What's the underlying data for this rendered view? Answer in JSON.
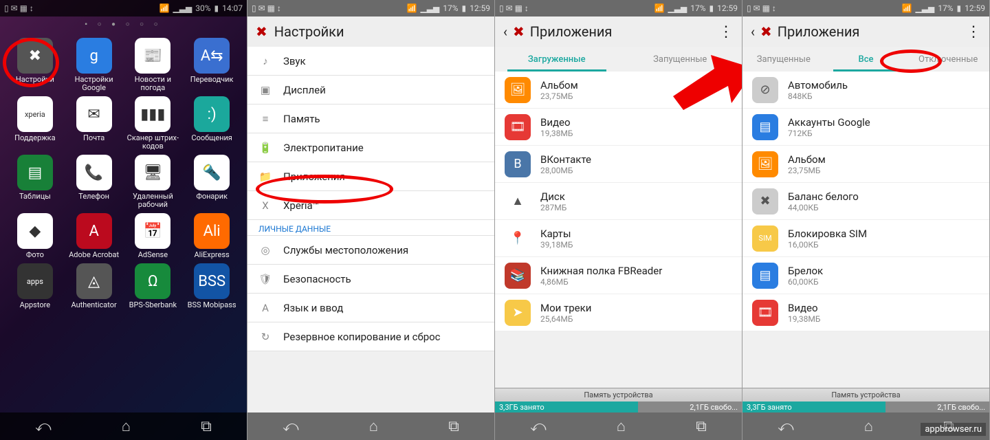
{
  "panel1": {
    "status": {
      "signal": "▁▃▅",
      "battery": "30%",
      "time": "14:07"
    },
    "dots": "▪ ○ ● ○ ○ ○",
    "apps": [
      {
        "label": "Настройки",
        "bg": "#555",
        "glyph": "✖"
      },
      {
        "label": "Настройки Google",
        "bg": "#2a7de1",
        "glyph": "g"
      },
      {
        "label": "Новости и погода",
        "bg": "#fff",
        "glyph": "📰"
      },
      {
        "label": "Переводчик",
        "bg": "#3a6fd0",
        "glyph": "A⇆"
      },
      {
        "label": "Поддержка",
        "bg": "#fff",
        "glyph": "xperia"
      },
      {
        "label": "Почта",
        "bg": "#fff",
        "glyph": "✉"
      },
      {
        "label": "Сканер штрих-кодов",
        "bg": "#fff",
        "glyph": "▮▮▮"
      },
      {
        "label": "Сообщения",
        "bg": "#1ba89c",
        "glyph": ":)"
      },
      {
        "label": "Таблицы",
        "bg": "#188038",
        "glyph": "▤"
      },
      {
        "label": "Телефон",
        "bg": "#fff",
        "glyph": "📞"
      },
      {
        "label": "Удаленный рабочий",
        "bg": "#fff",
        "glyph": "🖥"
      },
      {
        "label": "Фонарик",
        "bg": "#fff",
        "glyph": "🔦"
      },
      {
        "label": "Фото",
        "bg": "#fff",
        "glyph": "◆"
      },
      {
        "label": "Adobe Acrobat",
        "bg": "#bb0a1e",
        "glyph": "A"
      },
      {
        "label": "AdSense",
        "bg": "#fff",
        "glyph": "📅"
      },
      {
        "label": "AliExpress",
        "bg": "#ff6a00",
        "glyph": "Ali"
      },
      {
        "label": "Appstore",
        "bg": "#333",
        "glyph": "apps"
      },
      {
        "label": "Authenticator",
        "bg": "#555",
        "glyph": "◬"
      },
      {
        "label": "BPS-Sberbank",
        "bg": "#178a3c",
        "glyph": "Ω"
      },
      {
        "label": "BSS Mobipass",
        "bg": "#1254a5",
        "glyph": "BSS"
      }
    ]
  },
  "panel2": {
    "status": {
      "battery": "17%",
      "time": "12:59"
    },
    "title": "Настройки",
    "items": [
      {
        "icon": "♪",
        "label": "Звук"
      },
      {
        "icon": "▣",
        "label": "Дисплей"
      },
      {
        "icon": "≡",
        "label": "Память"
      },
      {
        "icon": "🔋",
        "label": "Электропитание"
      },
      {
        "icon": "📁",
        "label": "Приложения"
      },
      {
        "icon": "X",
        "label": "Xperia™"
      }
    ],
    "section": "ЛИЧНЫЕ ДАННЫЕ",
    "items2": [
      {
        "icon": "◎",
        "label": "Службы местоположения"
      },
      {
        "icon": "🛡",
        "label": "Безопасность"
      },
      {
        "icon": "A",
        "label": "Язык и ввод"
      },
      {
        "icon": "↻",
        "label": "Резервное копирование и сброс"
      }
    ]
  },
  "panel3": {
    "status": {
      "battery": "17%",
      "time": "12:59"
    },
    "title": "Приложения",
    "tabs": [
      "Загруженные",
      "Запущенные"
    ],
    "active_tab": 0,
    "apps": [
      {
        "name": "Альбом",
        "size": "23,75МБ",
        "bg": "#ff8a00",
        "glyph": "🖼"
      },
      {
        "name": "Видео",
        "size": "19,38МБ",
        "bg": "#e63935",
        "glyph": "🎞"
      },
      {
        "name": "ВКонтакте",
        "size": "28,00МБ",
        "bg": "#4a76a8",
        "glyph": "B"
      },
      {
        "name": "Диск",
        "size": "287МБ",
        "bg": "#fff",
        "glyph": "▲"
      },
      {
        "name": "Карты",
        "size": "39,18МБ",
        "bg": "#fff",
        "glyph": "📍"
      },
      {
        "name": "Книжная полка FBReader",
        "size": "4,86МБ",
        "bg": "#c0392b",
        "glyph": "📚"
      },
      {
        "name": "Мои треки",
        "size": "25,64МБ",
        "bg": "#f7c948",
        "glyph": "➤"
      }
    ],
    "mem_label": "Память устройства",
    "used": "3,3ГБ занято",
    "free": "2,1ГБ свобо..."
  },
  "panel4": {
    "status": {
      "battery": "17%",
      "time": "12:59"
    },
    "title": "Приложения",
    "tabs": [
      "Запущенные",
      "Все",
      "Отключенные"
    ],
    "active_tab": 1,
    "apps": [
      {
        "name": "Автомобиль",
        "size": "848КБ",
        "bg": "#ccc",
        "glyph": "⊘"
      },
      {
        "name": "Аккаунты Google",
        "size": "712КБ",
        "bg": "#2a7de1",
        "glyph": "▤"
      },
      {
        "name": "Альбом",
        "size": "23,75МБ",
        "bg": "#ff8a00",
        "glyph": "🖼"
      },
      {
        "name": "Баланс белого",
        "size": "44,00КБ",
        "bg": "#ccc",
        "glyph": "✖"
      },
      {
        "name": "Блокировка SIM",
        "size": "16,00КБ",
        "bg": "#f7c948",
        "glyph": "SIM"
      },
      {
        "name": "Брелок",
        "size": "60,00КБ",
        "bg": "#2a7de1",
        "glyph": "▤"
      },
      {
        "name": "Видео",
        "size": "19,38МБ",
        "bg": "#e63935",
        "glyph": "🎞"
      }
    ],
    "mem_label": "Память устройства",
    "used": "3,3ГБ занято",
    "free": "2,1ГБ свобо..."
  },
  "watermark": "appbrowser.ru"
}
